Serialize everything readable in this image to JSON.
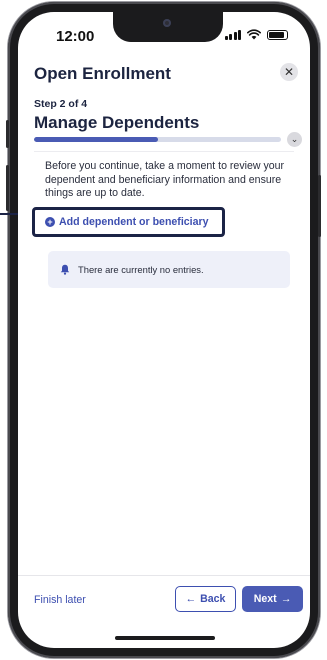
{
  "status_bar": {
    "time": "12:00",
    "icons": [
      "cellular-signal-icon",
      "wifi-icon",
      "battery-icon"
    ]
  },
  "header": {
    "title": "Open Enrollment",
    "close_icon": "close-icon"
  },
  "step": {
    "label": "Step 2 of 4",
    "title": "Manage Dependents",
    "progress_fraction": 0.5,
    "expand_icon": "chevron-down-icon"
  },
  "content": {
    "intro": "Before you continue, take a moment to review your dependent and beneficiary information and ensure things are up to date.",
    "add_link": "Add dependent or beneficiary",
    "add_icon": "plus-circle-icon",
    "empty_message": "There are currently no entries.",
    "empty_icon": "bell-icon"
  },
  "footer": {
    "finish_later": "Finish later",
    "back_label": "Back",
    "back_arrow": "←",
    "next_label": "Next",
    "next_arrow": "→"
  },
  "colors": {
    "accent": "#3d4fb0",
    "primary_button": "#4a5bb4",
    "heading": "#1c2440",
    "highlight_border": "#1b2346",
    "empty_state_bg": "#eef0f9"
  }
}
